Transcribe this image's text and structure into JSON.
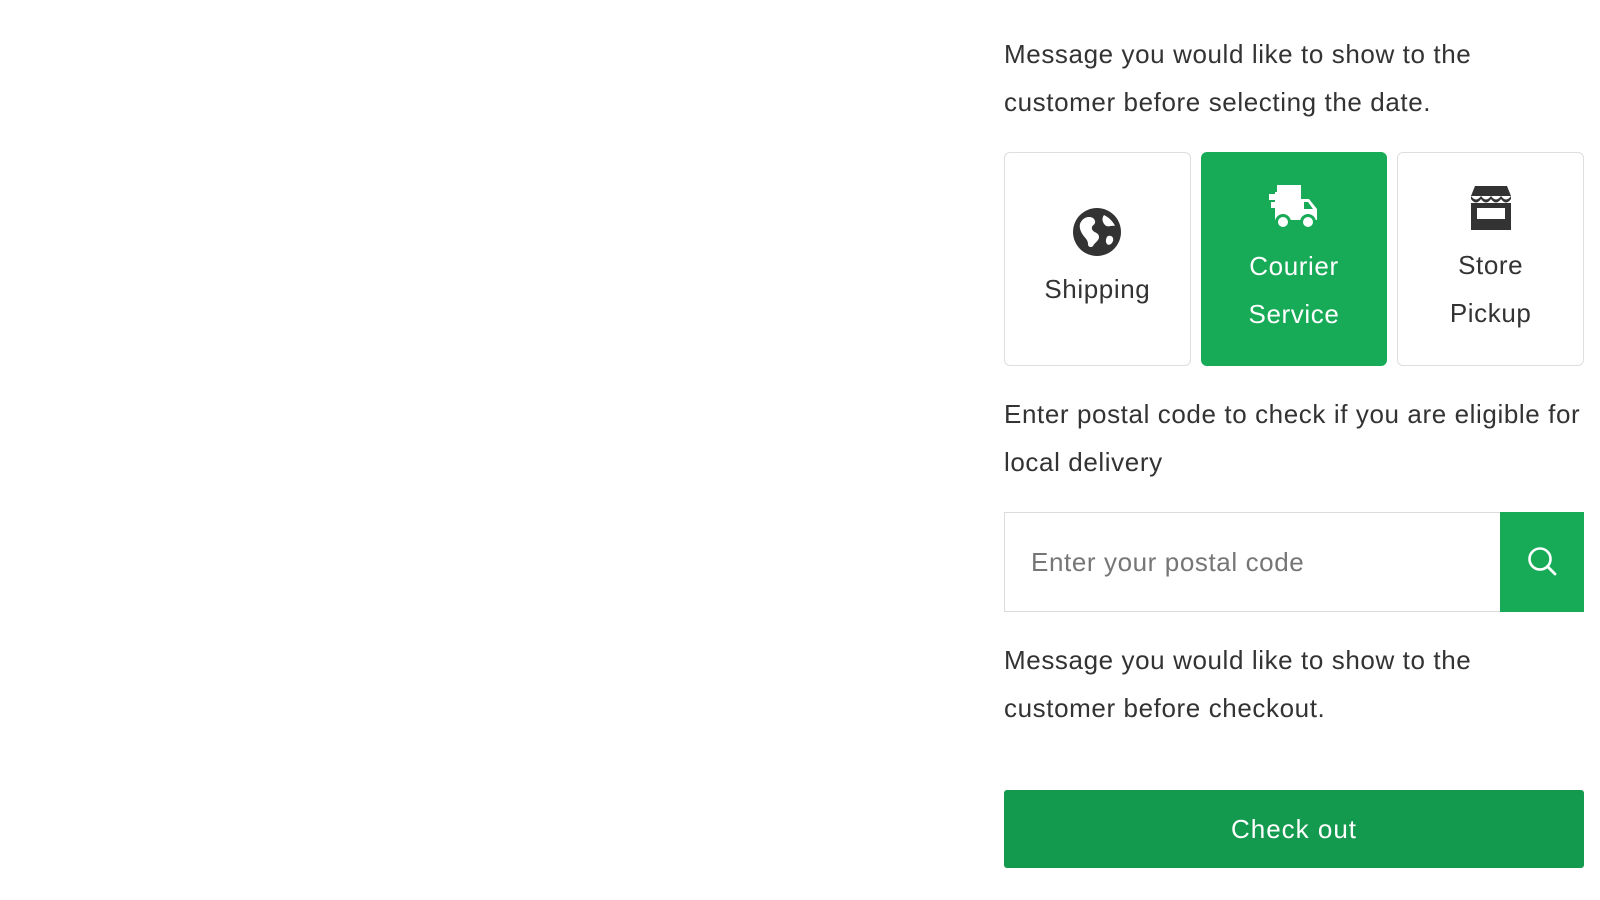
{
  "date_message": "Message you would like to show to the customer before selecting the date.",
  "delivery_options": [
    {
      "label": "Shipping",
      "icon": "globe-icon",
      "selected": false
    },
    {
      "label": "Courier Service",
      "icon": "delivery-truck-icon",
      "selected": true
    },
    {
      "label": "Store Pickup",
      "icon": "storefront-icon",
      "selected": false
    }
  ],
  "postal_message": "Enter postal code to check if you are eligible for local delivery",
  "postal_input": {
    "placeholder": "Enter your postal code",
    "value": ""
  },
  "search_button": {
    "icon": "search-icon"
  },
  "checkout_message": "Message you would like to show to the customer before checkout.",
  "checkout_button_label": "Check out",
  "colors": {
    "accent_green": "#17ab57",
    "checkout_green": "#139a4e",
    "text": "#333333",
    "border": "#dedede"
  }
}
